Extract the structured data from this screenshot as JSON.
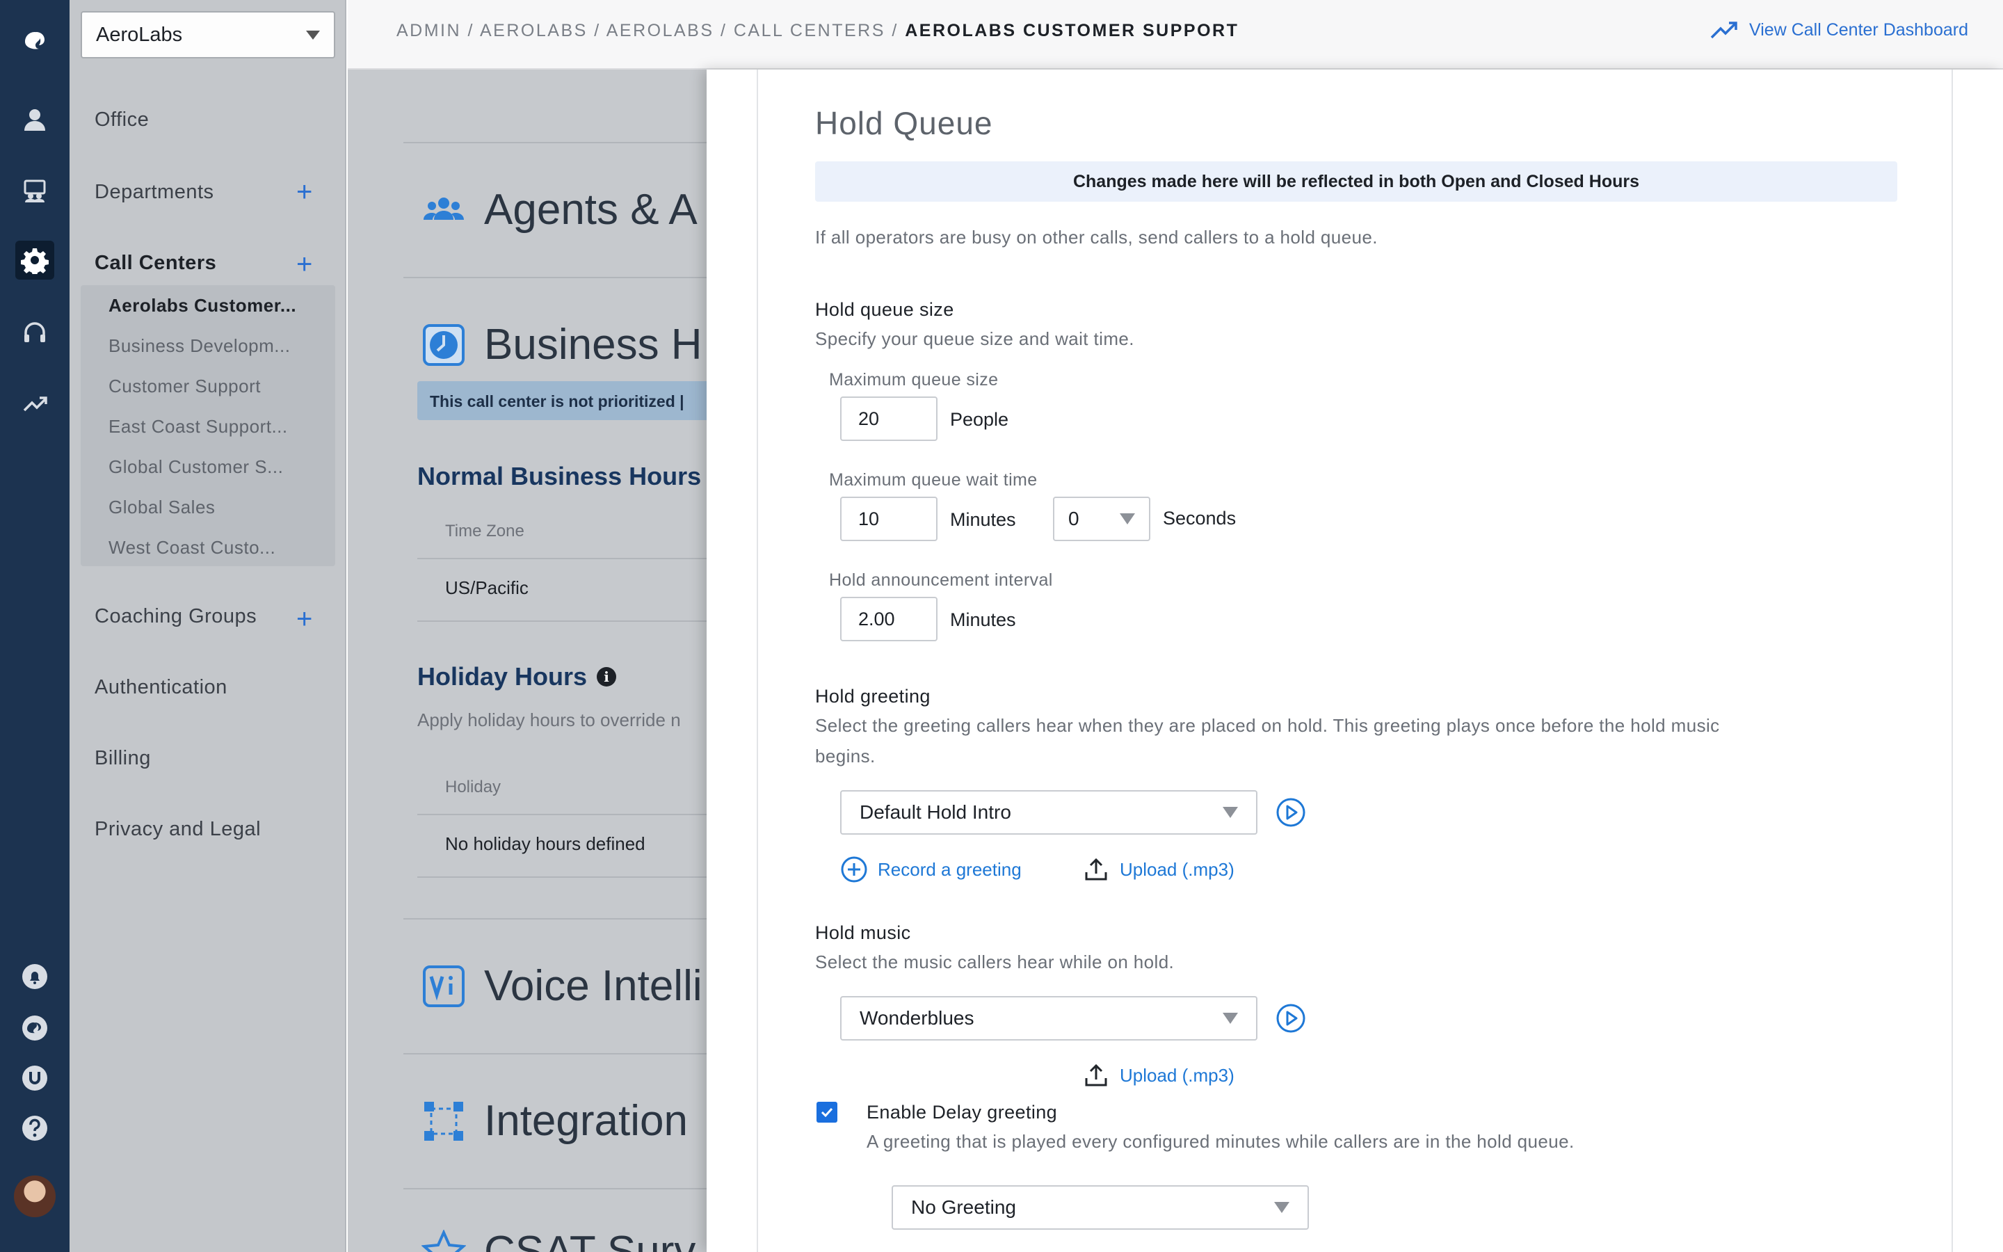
{
  "rail": {
    "icons": [
      "dialpad-logo-icon",
      "user-icon",
      "contact-center-icon",
      "gear-icon",
      "headset-icon",
      "analytics-icon",
      "bell-icon",
      "dialpad-icon",
      "ubersuggest-icon",
      "help-icon"
    ]
  },
  "sidebar": {
    "org": "AeroLabs",
    "office": "Office",
    "departments": "Departments",
    "call_centers": "Call Centers",
    "call_center_items": [
      "Aerolabs Customer...",
      "Business Developm...",
      "Customer Support",
      "East Coast Support...",
      "Global Customer S...",
      "Global Sales",
      "West Coast Custo..."
    ],
    "coaching_groups": "Coaching Groups",
    "authentication": "Authentication",
    "billing": "Billing",
    "privacy": "Privacy and Legal"
  },
  "header": {
    "crumb": "ADMIN / AEROLABS / AEROLABS / CALL CENTERS / ",
    "crumb_current": "AEROLABS CUSTOMER SUPPORT",
    "dashboard_link": "View Call Center Dashboard"
  },
  "background": {
    "agents": "Agents & A",
    "business": "Business H",
    "banner": "This call center is not prioritized | ",
    "normal_hours": "Normal Business Hours",
    "time_zone_label": "Time Zone",
    "time_zone_value": "US/Pacific",
    "holiday_hours": "Holiday Hours",
    "holiday_desc": "Apply holiday hours to override n",
    "holiday_col": "Holiday",
    "holiday_empty": "No holiday hours defined",
    "voice": "Voice Intelli",
    "integrations": "Integration",
    "csat": "CSAT Surv"
  },
  "panel": {
    "title": "Hold Queue",
    "notice": "Changes made here will be reflected in both Open and Closed Hours",
    "intro": "If all operators are busy on other calls, send callers to a hold queue.",
    "queue_size_title": "Hold queue size",
    "queue_size_desc": "Specify your queue size and wait time.",
    "max_size_label": "Maximum queue size",
    "max_size_value": "20",
    "max_size_unit": "People",
    "max_wait_label": "Maximum queue wait time",
    "max_wait_minutes": "10",
    "minutes_unit": "Minutes",
    "max_wait_seconds": "0",
    "seconds_unit": "Seconds",
    "announce_label": "Hold announcement interval",
    "announce_value": "2.00",
    "announce_unit": "Minutes",
    "greeting_title": "Hold greeting",
    "greeting_desc_1": "Select the greeting callers hear when they are placed on hold. This greeting plays once before the hold music",
    "greeting_desc_2": "begins.",
    "greeting_value": "Default Hold Intro",
    "record_link": "Record a greeting",
    "upload_link": "Upload (.mp3)",
    "music_title": "Hold music",
    "music_desc": "Select the music callers hear while on hold.",
    "music_value": "Wonderblues",
    "music_upload": "Upload (.mp3)",
    "delay_label": "Enable Delay greeting",
    "delay_checked": true,
    "delay_desc": "A greeting that is played every configured minutes while callers are in the hold queue.",
    "delay_value": "No Greeting"
  },
  "colors": {
    "rail": "#1c3350",
    "accent": "#1e78d6",
    "checkbox": "#1a6fde"
  }
}
